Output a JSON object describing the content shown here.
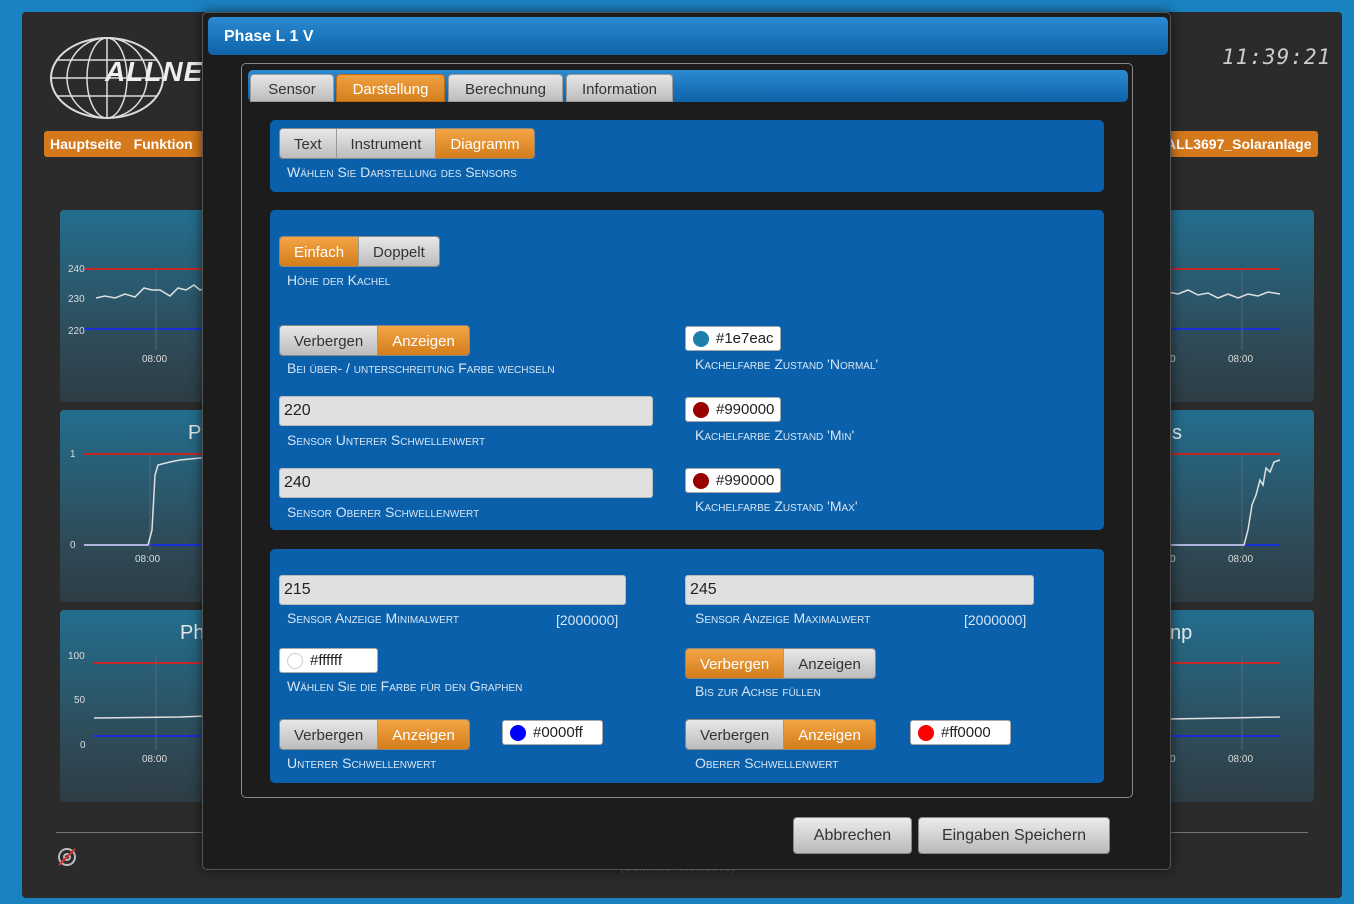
{
  "background": {
    "logo_text": "ALLNE",
    "clock": "11:39:21",
    "nav": [
      "Hauptseite",
      "Funktion"
    ],
    "device_name": "ALL3697_Solaranlage",
    "tiles": [
      {
        "title": "",
        "ticks": [
          "240",
          "230",
          "220"
        ],
        "time": "08:00"
      },
      {
        "title": "P",
        "ticks": [
          "1",
          "0"
        ],
        "time": "08:00"
      },
      {
        "title": "Ph",
        "ticks": [
          "100",
          "50",
          "0"
        ],
        "time": "08:00"
      },
      {
        "title": "",
        "ticks": [],
        "time": "08:00",
        "time2": "0"
      },
      {
        "title": "s",
        "ticks": [],
        "time": "08:00",
        "time2": "0"
      },
      {
        "title": "np",
        "ticks": [],
        "time": "08:00",
        "time2": "0"
      }
    ],
    "software": "(Software: 0.00.1071)"
  },
  "modal": {
    "title": "Phase L 1 V",
    "tabs": [
      "Sensor",
      "Darstellung",
      "Berechnung",
      "Information"
    ],
    "active_tab": "Darstellung",
    "display_mode": {
      "options": [
        "Text",
        "Instrument",
        "Diagramm"
      ],
      "selected": "Diagramm",
      "label": "Wählen Sie Darstellung des Sensors"
    },
    "tile_height": {
      "options": [
        "Einfach",
        "Doppelt"
      ],
      "selected": "Einfach",
      "label": "Höhe der Kachel"
    },
    "color_change": {
      "options": [
        "Verbergen",
        "Anzeigen"
      ],
      "selected": "Anzeigen",
      "label": "Bei über- / unterschreitung Farbe wechseln"
    },
    "lower_threshold": {
      "value": "220",
      "label": "Sensor Unterer Schwellenwert"
    },
    "upper_threshold": {
      "value": "240",
      "label": "Sensor Oberer Schwellenwert"
    },
    "color_normal": {
      "value": "#1e7eac",
      "label": "Kachelfarbe Zustand 'Normal'"
    },
    "color_min": {
      "value": "#990000",
      "label": "Kachelfarbe Zustand 'Min'"
    },
    "color_max": {
      "value": "#990000",
      "label": "Kachelfarbe Zustand 'Max'"
    },
    "display_min": {
      "value": "215",
      "label": "Sensor Anzeige Minimalwert",
      "extra": "[2000000]"
    },
    "display_max": {
      "value": "245",
      "label": "Sensor Anzeige Maximalwert",
      "extra": "[2000000]"
    },
    "graph_color": {
      "value": "#ffffff",
      "label": "Wählen Sie die Farbe für den Graphen"
    },
    "fill_axis": {
      "options": [
        "Verbergen",
        "Anzeigen"
      ],
      "selected": "Verbergen",
      "label": "Bis zur Achse füllen"
    },
    "lower_line": {
      "options": [
        "Verbergen",
        "Anzeigen"
      ],
      "selected": "Anzeigen",
      "label": "Unterer Schwellenwert",
      "color": "#0000ff"
    },
    "upper_line": {
      "options": [
        "Verbergen",
        "Anzeigen"
      ],
      "selected": "Anzeigen",
      "label": "Oberer Schwellenwert",
      "color": "#ff0000"
    },
    "cancel_label": "Abbrechen",
    "save_label": "Eingaben Speichern"
  }
}
